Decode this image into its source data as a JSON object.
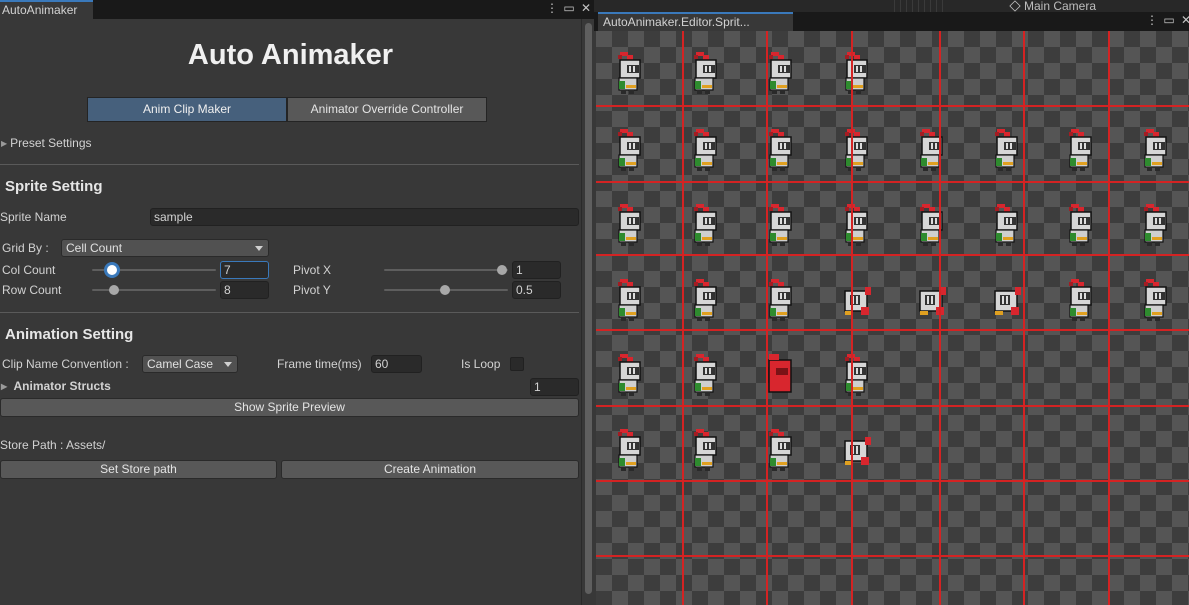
{
  "left_window": {
    "tab_title": "AutoAnimaker",
    "app_title": "Auto Animaker",
    "mode_tabs": [
      {
        "label": "Anim Clip Maker",
        "active": true
      },
      {
        "label": "Animator Override Controller",
        "active": false
      }
    ],
    "preset_settings": "Preset Settings",
    "sprite_setting": {
      "heading": "Sprite Setting",
      "sprite_name_label": "Sprite Name",
      "sprite_name_value": "sample",
      "grid_by_label": "Grid By :",
      "grid_by_value": "Cell Count",
      "col_count_label": "Col Count",
      "col_count_value": "7",
      "row_count_label": "Row Count",
      "row_count_value": "8",
      "pivot_x_label": "Pivot X",
      "pivot_x_value": "1",
      "pivot_y_label": "Pivot Y",
      "pivot_y_value": "0.5"
    },
    "animation_setting": {
      "heading": "Animation Setting",
      "clip_name_label": "Clip Name Convention :",
      "clip_name_value": "Camel Case",
      "frame_time_label": "Frame time(ms)",
      "frame_time_value": "60",
      "is_loop_label": "Is Loop",
      "is_loop_checked": false,
      "animator_structs_label": "Animator Structs",
      "animator_structs_count": "1",
      "show_preview_label": "Show Sprite Preview"
    },
    "store": {
      "path_label": "Store Path : Assets/",
      "set_path_label": "Set Store path",
      "create_label": "Create Animation"
    }
  },
  "right_window": {
    "tab_title": "AutoAnimaker.Editor.Sprit...",
    "scene_object": "Main Camera",
    "sprite_rows": [
      {
        "count": 4,
        "variants": [
          "knight",
          "knight",
          "knight",
          "knight"
        ]
      },
      {
        "count": 8,
        "variants": [
          "knight",
          "knight",
          "knight",
          "knight",
          "knight",
          "knight",
          "knight",
          "knight"
        ]
      },
      {
        "count": 8,
        "variants": [
          "knight",
          "knight",
          "knight",
          "knight",
          "knight",
          "knight",
          "knight",
          "knight"
        ]
      },
      {
        "count": 8,
        "variants": [
          "knight",
          "knight",
          "knight",
          "turn",
          "side",
          "side-flip",
          "knight",
          "knight"
        ]
      },
      {
        "count": 4,
        "variants": [
          "knight",
          "knight",
          "hit",
          "knight"
        ]
      },
      {
        "count": 4,
        "variants": [
          "knight",
          "knight",
          "knight",
          "fallen"
        ]
      }
    ]
  },
  "colors": {
    "accent": "#3a79bb",
    "active_tab": "#46607c",
    "grid_line": "#d42323",
    "panel_bg": "#383838"
  },
  "icons": [
    "more-options-icon",
    "maximize-icon",
    "close-icon",
    "foldout-arrow-icon",
    "game-object-icon"
  ]
}
